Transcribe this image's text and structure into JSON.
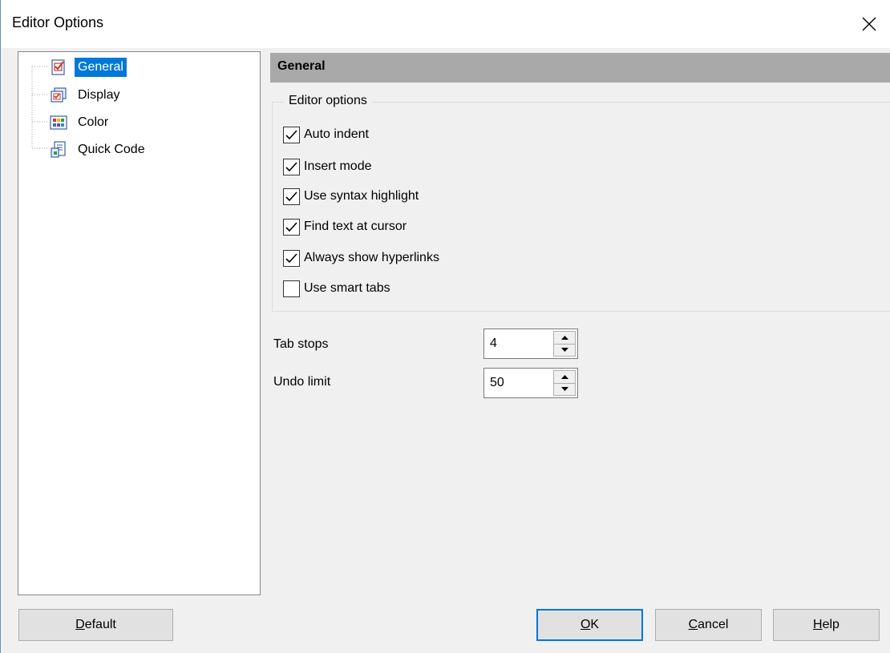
{
  "window": {
    "title": "Editor Options"
  },
  "tree": {
    "items": [
      {
        "label": "General",
        "icon": "checked-page-icon",
        "selected": true
      },
      {
        "label": "Display",
        "icon": "display-icon",
        "selected": false
      },
      {
        "label": "Color",
        "icon": "color-grid-icon",
        "selected": false
      },
      {
        "label": "Quick Code",
        "icon": "quick-code-icon",
        "selected": false
      }
    ]
  },
  "page": {
    "header": "General",
    "group_title": "Editor options",
    "options": [
      {
        "label": "Auto indent",
        "checked": true
      },
      {
        "label": "Insert mode",
        "checked": true
      },
      {
        "label": "Use syntax highlight",
        "checked": true
      },
      {
        "label": "Find text at cursor",
        "checked": true
      },
      {
        "label": "Always show hyperlinks",
        "checked": true
      },
      {
        "label": "Use smart tabs",
        "checked": false
      }
    ],
    "tab_stops": {
      "label": "Tab stops",
      "value": "4"
    },
    "undo_limit": {
      "label": "Undo limit",
      "value": "50"
    }
  },
  "buttons": {
    "default_pre": "",
    "default_mnemonic": "D",
    "default_post": "efault",
    "ok_pre": "",
    "ok_mnemonic": "O",
    "ok_post": "K",
    "cancel_pre": "",
    "cancel_mnemonic": "C",
    "cancel_post": "ancel",
    "help_pre": "",
    "help_mnemonic": "H",
    "help_post": "elp"
  },
  "colors": {
    "selection": "#0078d7",
    "header_bg": "#a9a9a9",
    "focus_border": "#0078d7"
  }
}
